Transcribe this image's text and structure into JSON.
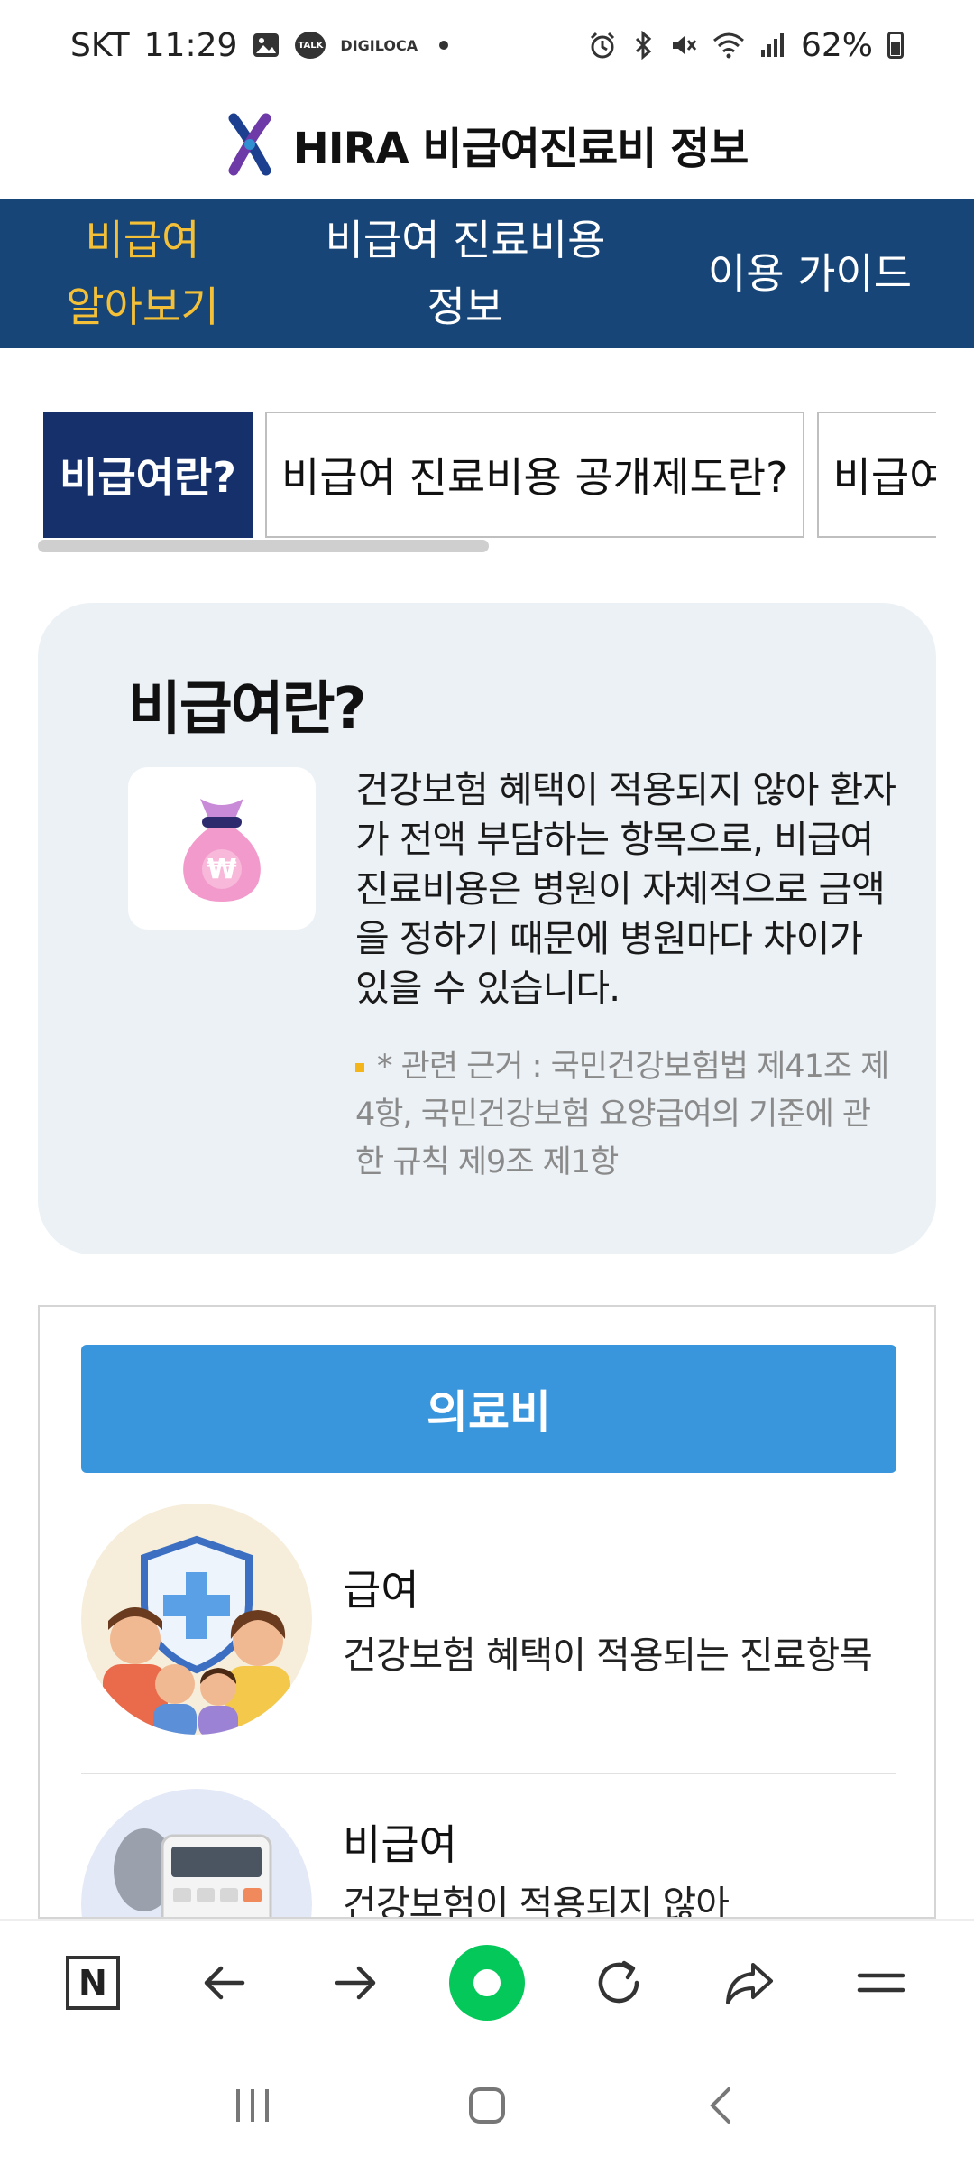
{
  "status_bar": {
    "carrier": "SKT",
    "time": "11:29",
    "talk_label": "TALK",
    "digi_label_1": "DIGI",
    "digi_label_2": "LOCA",
    "battery": "62%"
  },
  "header": {
    "title": "HIRA 비급여진료비 정보"
  },
  "main_nav": {
    "items": [
      {
        "line1": "비급여",
        "line2": "알아보기"
      },
      {
        "line1": "비급여 진료비용",
        "line2": "정보"
      },
      {
        "line1": "이용 가이드",
        "line2": ""
      }
    ]
  },
  "sub_tabs": {
    "items": [
      {
        "label": "비급여란?"
      },
      {
        "label": "비급여 진료비용 공개제도란?"
      },
      {
        "label": "비급여"
      }
    ]
  },
  "info_card": {
    "title": "비급여란?",
    "description": "건강보험 혜택이 적용되지 않아 환자가 전액 부담하는 항목으로, 비급여 진료비용은 병원이 자체적으로 금액을 정하기 때문에 병원마다 차이가 있을 수 있습니다.",
    "basis": "* 관련 근거 : 국민건강보험법 제41조 제4항, 국민건강보험 요양급여의 기준에 관한 규칙 제9조 제1항"
  },
  "expense_section": {
    "header": "의료비",
    "items": [
      {
        "title": "급여",
        "description": "건강보험 혜택이 적용되는 진료항목"
      },
      {
        "title": "비급여",
        "description": "건강보험이 적용되지 않아"
      }
    ]
  },
  "browser_toolbar": {
    "n_label": "N"
  },
  "colors": {
    "nav_bg": "#174577",
    "nav_active": "#f4c038",
    "tab_active_bg": "#16306b",
    "card_bg": "#ebf1f5",
    "expense_header_bg": "#3a96dc",
    "green_button": "#05c85a"
  }
}
